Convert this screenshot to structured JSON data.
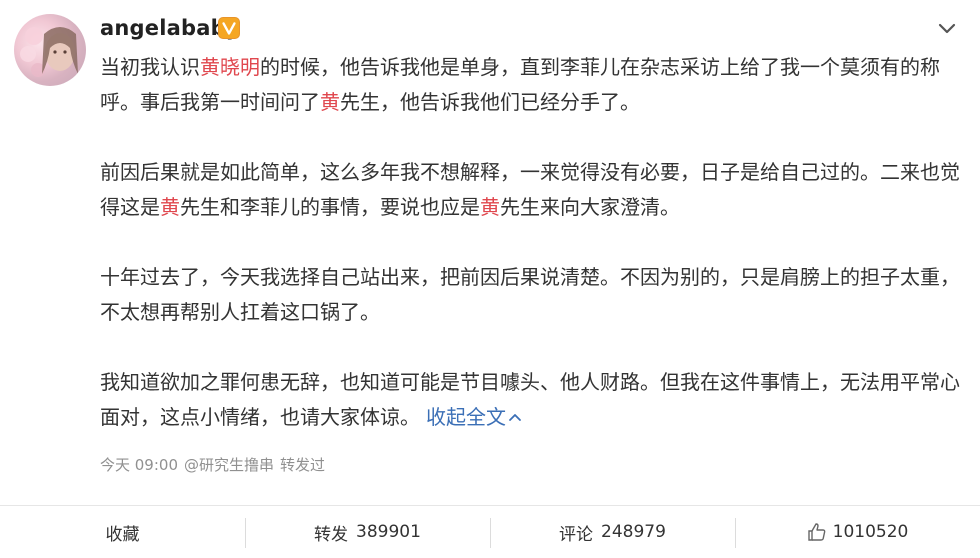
{
  "post": {
    "username": "angelababy",
    "verified_icon": "verified-v-icon",
    "paragraphs": [
      [
        {
          "text": "当初我认识"
        },
        {
          "text": "黄晓明",
          "hl": true
        },
        {
          "text": "的时候，他告诉我他是单身，直到李菲儿在杂志采访上给了我一个莫须有的称呼。事后我第一时间问了"
        },
        {
          "text": "黄",
          "hl": true
        },
        {
          "text": "先生，他告诉我他们已经分手了。"
        }
      ],
      [
        {
          "text": "前因后果就是如此简单，这么多年我不想解释，一来觉得没有必要，日子是给自己过的。二来也觉得这是"
        },
        {
          "text": "黄",
          "hl": true
        },
        {
          "text": "先生和李菲儿的事情，要说也应是"
        },
        {
          "text": "黄",
          "hl": true
        },
        {
          "text": "先生来向大家澄清。"
        }
      ],
      [
        {
          "text": "十年过去了，今天我选择自己站出来，把前因后果说清楚。不因为别的，只是肩膀上的担子太重，不太想再帮别人扛着这口锅了。"
        }
      ],
      [
        {
          "text": "我知道欲加之罪何患无辞，也知道可能是节目噱头、他人财路。但我在这件事情上，无法用平常心面对，这点小情绪，也请大家体谅。"
        }
      ]
    ],
    "collapse_label": "收起全文",
    "meta": {
      "time": "今天 09:00",
      "via": "@研究生撸串",
      "via_suffix": "转发过"
    }
  },
  "actions": {
    "favorite_label": "收藏",
    "repost_label": "转发",
    "repost_count": "389901",
    "comment_label": "评论",
    "comment_count": "248979",
    "like_count": "1010520"
  },
  "colors": {
    "highlight": "#e0474e",
    "link": "#3b6fb6",
    "badge": "#f5a623"
  }
}
